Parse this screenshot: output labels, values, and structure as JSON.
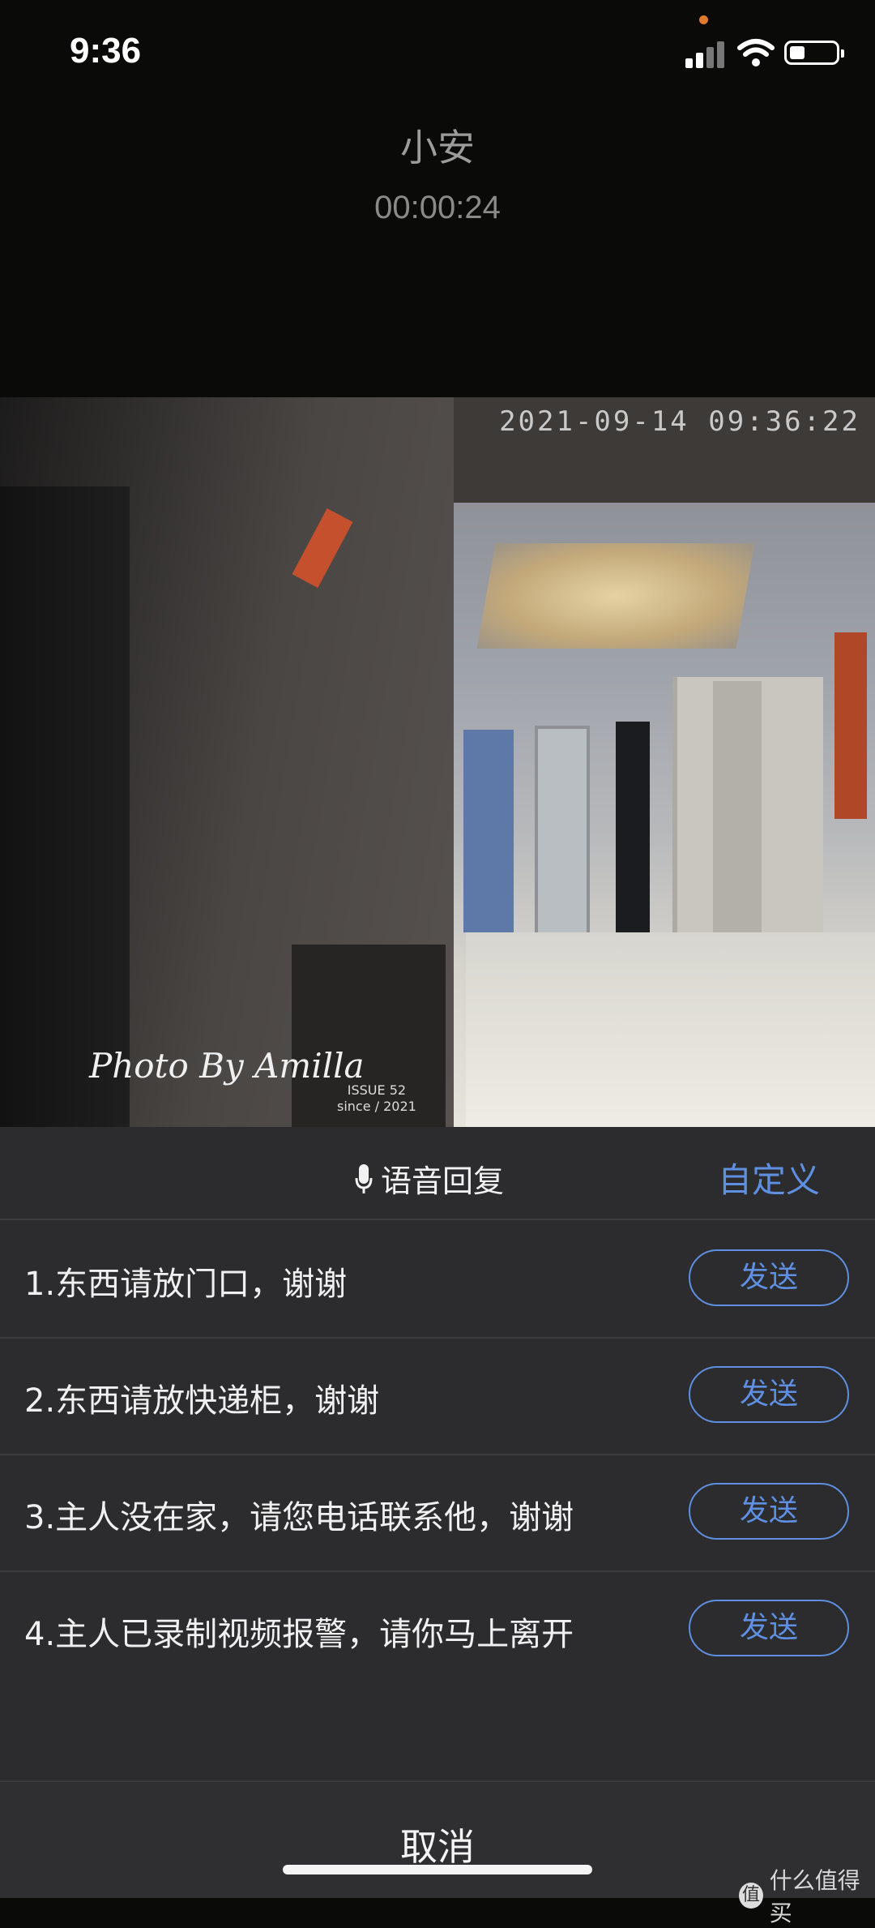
{
  "status_bar": {
    "time": "9:36"
  },
  "caller": {
    "name": "小安",
    "duration": "00:00:24"
  },
  "video": {
    "timestamp": "2021-09-14 09:36:22",
    "watermark": "Photo By Amilla",
    "issue_line1": "ISSUE 52",
    "issue_line2": "since / 2021"
  },
  "voice_reply": {
    "title": "语音回复",
    "custom_label": "自定义",
    "send_label": "发送",
    "items": [
      {
        "text": "1.东西请放门口，谢谢"
      },
      {
        "text": "2.东西请放快递柜，谢谢"
      },
      {
        "text": "3.主人没在家，请您电话联系他，谢谢"
      },
      {
        "text": "4.主人已录制视频报警，请你马上离开"
      }
    ],
    "cancel_label": "取消"
  },
  "corner_logo": {
    "badge": "值",
    "text": "什么值得买"
  },
  "colors": {
    "accent": "#5f8fe0",
    "sheet": "#2c2c2e",
    "background": "#0a0a08"
  },
  "icons": [
    "signal-icon",
    "wifi-icon",
    "battery-icon",
    "microphone-icon"
  ]
}
